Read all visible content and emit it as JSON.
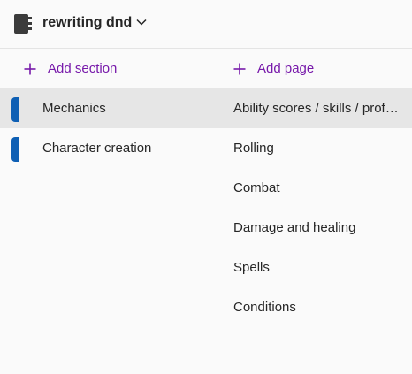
{
  "notebook": {
    "title": "rewriting dnd",
    "icon": "notebook-icon",
    "dropdown_icon": "chevron-down-icon"
  },
  "sections_pane": {
    "add_label": "Add section",
    "items": [
      {
        "label": "Mechanics",
        "selected": true,
        "color": "#0e5fb4"
      },
      {
        "label": "Character creation",
        "selected": false,
        "color": "#0e5fb4"
      }
    ]
  },
  "pages_pane": {
    "add_label": "Add page",
    "items": [
      {
        "label": "Ability scores / skills / proficiency",
        "selected": true
      },
      {
        "label": "Rolling",
        "selected": false
      },
      {
        "label": "Combat",
        "selected": false
      },
      {
        "label": "Damage and healing",
        "selected": false
      },
      {
        "label": "Spells",
        "selected": false
      },
      {
        "label": "Conditions",
        "selected": false
      }
    ]
  },
  "colors": {
    "accent": "#7719aa",
    "section_tab": "#0e5fb4",
    "selected_bg": "#e6e6e6"
  }
}
